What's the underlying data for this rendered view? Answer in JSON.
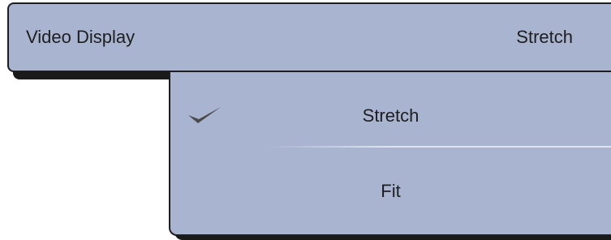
{
  "setting": {
    "label": "Video Display",
    "current_value": "Stretch"
  },
  "options": [
    {
      "label": "Stretch",
      "selected": true,
      "icon": "checkmark-icon"
    },
    {
      "label": "Fit",
      "selected": false
    }
  ],
  "colors": {
    "panel": "#a9b4d0",
    "border": "#1e1e1e",
    "shadow": "#1a1a1a",
    "text": "#1e1e1e",
    "checkmark": "#4a4a4a"
  }
}
